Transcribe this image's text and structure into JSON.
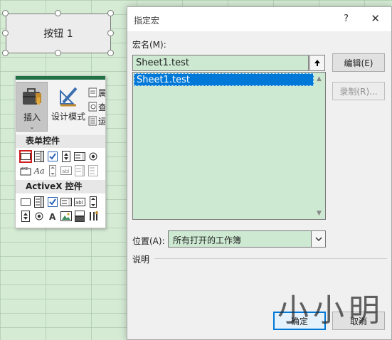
{
  "sheet_button": {
    "label": "按钮 1"
  },
  "ribbon": {
    "insert_label": "插入",
    "insert_arrow": "⌄",
    "design_mode_label": "设计模式",
    "mini_items": [
      "属",
      "查",
      "运"
    ],
    "form_controls_header": "表单控件",
    "activex_header": "ActiveX 控件"
  },
  "dialog": {
    "title": "指定宏",
    "help_glyph": "?",
    "close_glyph": "✕",
    "macro_name_label": "宏名(M):",
    "macro_name_value": "Sheet1.test",
    "macros": [
      "Sheet1.test"
    ],
    "edit_button": "编辑(E)",
    "record_button": "录制(R)...",
    "location_label": "位置(A):",
    "location_value": "所有打开的工作簿",
    "description_label": "说明",
    "ok_button": "确定",
    "cancel_button": "取消"
  },
  "watermark": "小小明",
  "colors": {
    "accent": "#0078d7",
    "excel_green": "#217346",
    "sheet_bg": "#d5ebd4",
    "field_bg": "#cde9d2",
    "highlight_border": "#d02020"
  }
}
